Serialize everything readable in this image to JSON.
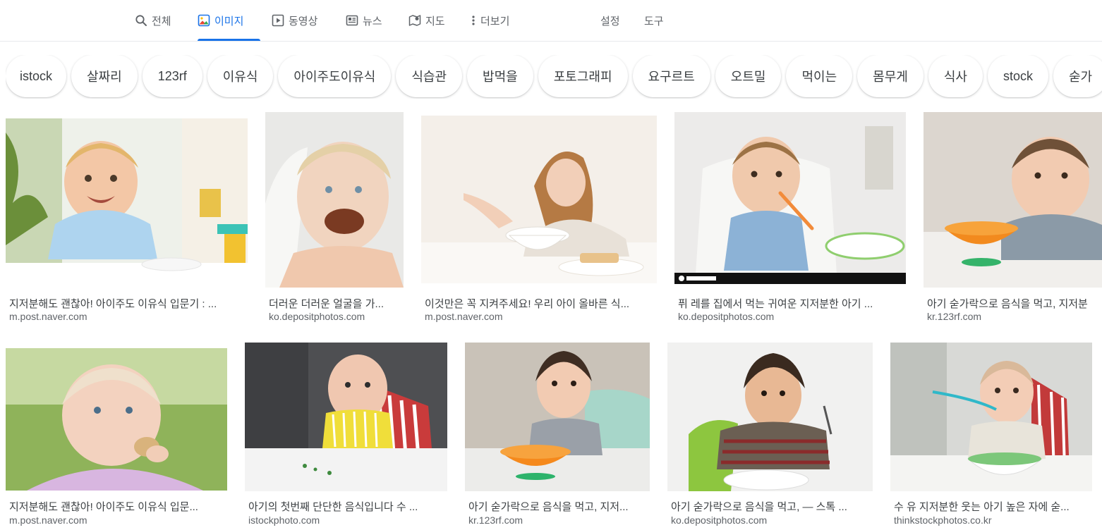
{
  "nav": {
    "tabs": [
      {
        "label": "전체",
        "icon": "search-icon"
      },
      {
        "label": "이미지",
        "icon": "image-icon",
        "active": true
      },
      {
        "label": "동영상",
        "icon": "video-icon"
      },
      {
        "label": "뉴스",
        "icon": "news-icon"
      },
      {
        "label": "지도",
        "icon": "map-icon"
      },
      {
        "label": "더보기",
        "icon": "more-vert-icon"
      }
    ],
    "settings_label": "설정",
    "tools_label": "도구",
    "accent_color": "#1a73e8"
  },
  "chips": [
    "istock",
    "살짜리",
    "123rf",
    "이유식",
    "아이주도이유식",
    "식습관",
    "밥먹을",
    "포토그래피",
    "요구르트",
    "오트밀",
    "먹이는",
    "몸무게",
    "식사",
    "stock",
    "숟가"
  ],
  "results": [
    {
      "title": "지저분해도 괜찮아! 아이주도 이유식 입문기 : ...",
      "source": "m.post.naver.com"
    },
    {
      "title": "더러운 더러운 얼굴을 가...",
      "source": "ko.depositphotos.com"
    },
    {
      "title": "이것만은 꼭 지켜주세요! 우리 아이 올바른 식...",
      "source": "m.post.naver.com"
    },
    {
      "title": "퓌 레를 집에서 먹는 귀여운 지저분한 아기 ...",
      "source": "ko.depositphotos.com"
    },
    {
      "title": "아기 숟가락으로 음식을 먹고, 지저분",
      "source": "kr.123rf.com"
    },
    {
      "title": "지저분해도 괜찮아! 아이주도 이유식 입문...",
      "source": "m.post.naver.com"
    },
    {
      "title": "아기의 첫번째 단단한 음식입니다 수 ...",
      "source": "istockphoto.com"
    },
    {
      "title": "아기 숟가락으로 음식을 먹고, 지저...",
      "source": "kr.123rf.com"
    },
    {
      "title": "아기 숟가락으로 음식을 먹고, — 스톡 ...",
      "source": "ko.depositphotos.com"
    },
    {
      "title": "수 유 지저분한 웃는 아기 높은 자에 숟...",
      "source": "thinkstockphotos.co.kr"
    }
  ]
}
